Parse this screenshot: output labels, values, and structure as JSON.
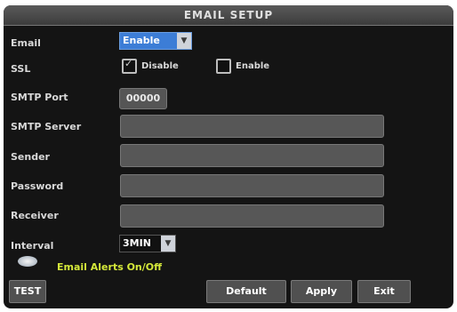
{
  "title": "EMAIL SETUP",
  "fields": {
    "email_label": "Email",
    "email_value": "Enable",
    "ssl_label": "SSL",
    "ssl_disable_label": "Disable",
    "ssl_enable_label": "Enable",
    "smtp_port_label": "SMTP  Port",
    "smtp_port_value": "00000",
    "smtp_server_label": "SMTP  Server",
    "sender_label": "Sender",
    "password_label": "Password",
    "receiver_label": "Receiver",
    "interval_label": "Interval",
    "interval_value": "3MIN"
  },
  "alert": {
    "text": "Email  Alerts  On/Off"
  },
  "buttons": {
    "test": "TEST",
    "default": "Default",
    "apply": "Apply",
    "exit": "Exit"
  },
  "state": {
    "ssl_disable_checked": true,
    "ssl_enable_checked": false
  },
  "colors": {
    "accent": "#3c7dd6",
    "alert_text": "#d4e83a"
  }
}
